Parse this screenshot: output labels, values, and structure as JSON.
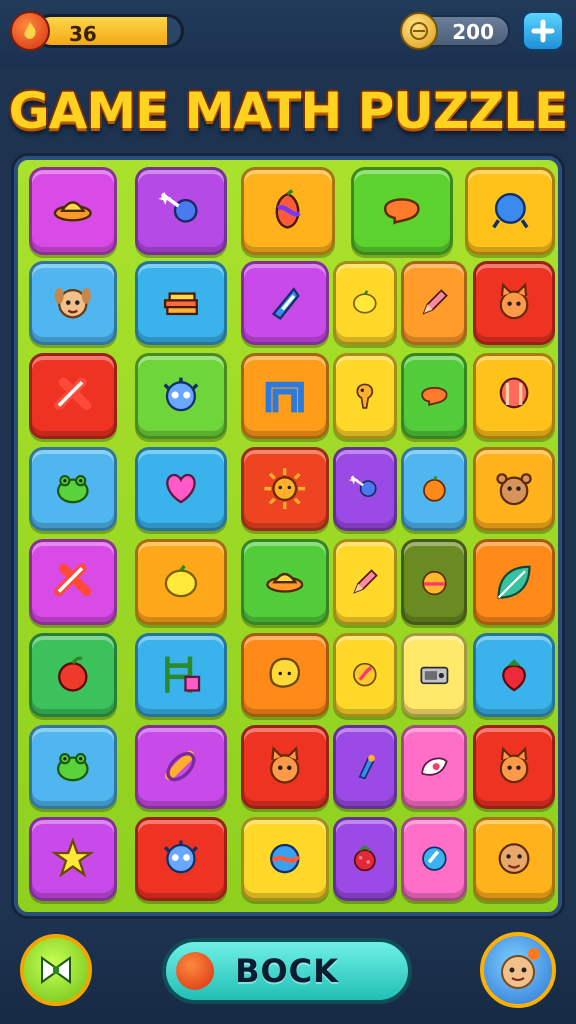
{
  "hud": {
    "energy_value": "36",
    "energy_fill": 0.9,
    "coins": "200",
    "energy_icon": "flame-icon",
    "coin_icon": "coin-icon",
    "add_icon": "plus-icon"
  },
  "title": "GAME MATH PUZZLE",
  "footer": {
    "back_label": "BOCK",
    "left_icon": "bow-icon",
    "right_icon": "profile-avatar-icon"
  },
  "colors": {
    "board": "#a9e22c",
    "title": "#ffd21f",
    "background": "#1d3350"
  },
  "tiles": [
    {
      "color": "#d84be6",
      "icon": "ufo"
    },
    {
      "color": "#b54ae6",
      "icon": "comet"
    },
    {
      "color": "#ffb21c",
      "icon": "fruit"
    },
    {
      "color": "#5cd22e",
      "icon": "bubble"
    },
    {
      "color": "#ffc21a",
      "icon": "ball"
    },
    {
      "color": "#4fb6f0",
      "icon": "dog"
    },
    {
      "color": "#3ab2ec",
      "icon": "books"
    },
    {
      "color": "#c84ae8",
      "icon": "candy"
    },
    {
      "color": "#ffd82a",
      "icon": "lemon"
    },
    {
      "color": "#ff9c2a",
      "icon": "pencil"
    },
    {
      "color": "#ee3322",
      "icon": "cat"
    },
    {
      "color": "#ee3322",
      "icon": "cross"
    },
    {
      "color": "#6ed63a",
      "icon": "monster"
    },
    {
      "color": "#ff9c1a",
      "icon": "arch"
    },
    {
      "color": "#ffd82a",
      "icon": "bird"
    },
    {
      "color": "#52cc3a",
      "icon": "bubble"
    },
    {
      "color": "#ffc21a",
      "icon": "balloon"
    },
    {
      "color": "#4fb6f0",
      "icon": "frog"
    },
    {
      "color": "#3ab2ec",
      "icon": "heart"
    },
    {
      "color": "#ee4422",
      "icon": "sun"
    },
    {
      "color": "#9c4ae6",
      "icon": "comet"
    },
    {
      "color": "#4fb6f0",
      "icon": "orange"
    },
    {
      "color": "#ffb21c",
      "icon": "bear"
    },
    {
      "color": "#d84be6",
      "icon": "cross"
    },
    {
      "color": "#ffa81a",
      "icon": "lemon"
    },
    {
      "color": "#52cc3a",
      "icon": "ufo"
    },
    {
      "color": "#ffd82a",
      "icon": "pencil"
    },
    {
      "color": "#6a8a22",
      "icon": "peach"
    },
    {
      "color": "#ff8a1a",
      "icon": "leaf"
    },
    {
      "color": "#3cc25a",
      "icon": "apple"
    },
    {
      "color": "#3ab2ec",
      "icon": "ladder"
    },
    {
      "color": "#ff8a1a",
      "icon": "blob"
    },
    {
      "color": "#ffd82a",
      "icon": "coin"
    },
    {
      "color": "#ffe86a",
      "icon": "radio"
    },
    {
      "color": "#3ab2ec",
      "icon": "strawberry"
    },
    {
      "color": "#4fb6f0",
      "icon": "frog"
    },
    {
      "color": "#c84ae8",
      "icon": "bone"
    },
    {
      "color": "#ee3322",
      "icon": "cat"
    },
    {
      "color": "#9c4ae6",
      "icon": "bottle"
    },
    {
      "color": "#ff6fc8",
      "icon": "shell"
    },
    {
      "color": "#ee3322",
      "icon": "cat"
    },
    {
      "color": "#c84ae8",
      "icon": "star"
    },
    {
      "color": "#ee3322",
      "icon": "monster"
    },
    {
      "color": "#ffd82a",
      "icon": "planet"
    },
    {
      "color": "#9c4ae6",
      "icon": "berry"
    },
    {
      "color": "#ff6fc8",
      "icon": "gem"
    },
    {
      "color": "#ffb21c",
      "icon": "face"
    }
  ]
}
